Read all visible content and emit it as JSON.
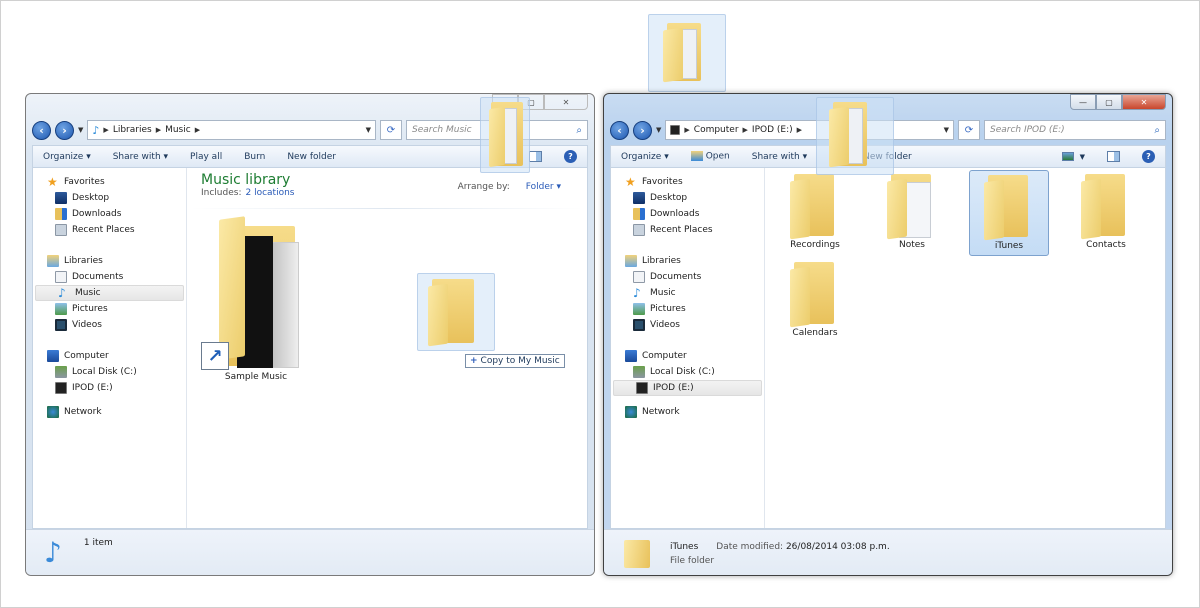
{
  "left_window": {
    "address": {
      "icon": "music-note-icon",
      "crumbs": [
        "Libraries",
        "Music"
      ]
    },
    "search_placeholder": "Search Music",
    "toolbar": [
      "Organize",
      "Share with",
      "Play all",
      "Burn",
      "New folder"
    ],
    "nav": {
      "favorites": {
        "label": "Favorites",
        "items": [
          "Desktop",
          "Downloads",
          "Recent Places"
        ]
      },
      "libraries": {
        "label": "Libraries",
        "items": [
          "Documents",
          "Music",
          "Pictures",
          "Videos"
        ]
      },
      "computer": {
        "label": "Computer",
        "items": [
          "Local Disk (C:)",
          "IPOD (E:)"
        ]
      },
      "network": {
        "label": "Network"
      }
    },
    "selected_nav": "Music",
    "library_title": "Music library",
    "includes_label": "Includes:",
    "includes_link": "2 locations",
    "arrange_label": "Arrange by:",
    "arrange_value": "Folder",
    "items": [
      {
        "name": "Sample Music",
        "type": "shortcut-folder"
      }
    ],
    "status": "1 item",
    "drop_tooltip": "Copy to My Music"
  },
  "right_window": {
    "address": {
      "icon": "drive-icon",
      "crumbs": [
        "Computer",
        "IPOD (E:)"
      ]
    },
    "search_placeholder": "Search IPOD (E:)",
    "toolbar": [
      "Organize",
      "Open",
      "Share with",
      "New folder"
    ],
    "nav": {
      "favorites": {
        "label": "Favorites",
        "items": [
          "Desktop",
          "Downloads",
          "Recent Places"
        ]
      },
      "libraries": {
        "label": "Libraries",
        "items": [
          "Documents",
          "Music",
          "Pictures",
          "Videos"
        ]
      },
      "computer": {
        "label": "Computer",
        "items": [
          "Local Disk (C:)",
          "IPOD (E:)"
        ]
      },
      "network": {
        "label": "Network"
      }
    },
    "selected_nav": "IPOD (E:)",
    "folders": [
      "Recordings",
      "Notes",
      "iTunes",
      "Contacts",
      "Calendars"
    ],
    "selected_folder": "iTunes",
    "details": {
      "name": "iTunes",
      "type": "File folder",
      "date_label": "Date modified:",
      "date_value": "26/08/2014 03:08 p.m."
    }
  },
  "caption_buttons": {
    "minimize": "—",
    "maximize": "▢",
    "close": "✕"
  }
}
